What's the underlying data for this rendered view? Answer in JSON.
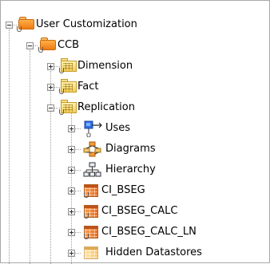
{
  "tree": {
    "root": {
      "label": "User Customization",
      "icon": "orange-folder-icon"
    },
    "ccb": {
      "label": "CCB",
      "icon": "orange-folder-icon"
    },
    "dimension": {
      "label": "Dimension",
      "icon": "yellow-folder-icon"
    },
    "fact": {
      "label": "Fact",
      "icon": "yellow-folder-icon"
    },
    "replication": {
      "label": "Replication",
      "icon": "yellow-folder-icon"
    },
    "uses": {
      "label": "Uses",
      "icon": "arrow-uses-icon"
    },
    "diagrams": {
      "label": "Diagrams",
      "icon": "diagram-icon"
    },
    "hierarchy": {
      "label": "Hierarchy",
      "icon": "hierarchy-icon"
    },
    "ci_bseg": {
      "label": "CI_BSEG",
      "icon": "table-icon"
    },
    "ci_bseg_calc": {
      "label": "CI_BSEG_CALC",
      "icon": "table-icon"
    },
    "ci_bseg_calc_ln": {
      "label": "CI_BSEG_CALC_LN",
      "icon": "table-icon"
    },
    "hidden_datastores": {
      "label": "Hidden Datastores",
      "icon": "table-icon"
    }
  }
}
